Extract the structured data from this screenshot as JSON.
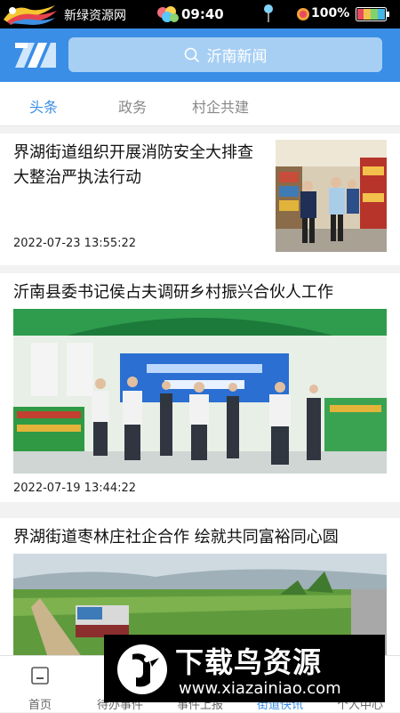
{
  "status_bar": {
    "app_name": "新绿资源网",
    "time": "09:40",
    "battery": "100%"
  },
  "header": {
    "search_placeholder": "沂南新闻"
  },
  "tabs": [
    {
      "label": "头条",
      "active": true
    },
    {
      "label": "政务",
      "active": false
    },
    {
      "label": "村企共建",
      "active": false
    }
  ],
  "articles": [
    {
      "title": "界湖街道组织开展消防安全大排查大整治严执法行动",
      "date": "2022-07-23 13:55:22"
    },
    {
      "title": "沂南县委书记侯占夫调研乡村振兴合伙人工作",
      "date": "2022-07-19 13:44:22"
    },
    {
      "title": "界湖街道枣林庄社企合作 绘就共同富裕同心圆",
      "date": ""
    }
  ],
  "bottom_nav": [
    {
      "label": "首页",
      "icon": "home-icon",
      "active": false
    },
    {
      "label": "待办事件",
      "icon": "todo-icon",
      "active": false
    },
    {
      "label": "事件上报",
      "icon": "report-icon",
      "active": false
    },
    {
      "label": "街道快讯",
      "icon": "news-icon",
      "active": true
    },
    {
      "label": "个人中心",
      "icon": "user-icon",
      "active": false
    }
  ],
  "watermark": {
    "title": "下载鸟资源",
    "url": "www.xiazainiao.com"
  },
  "colors": {
    "primary": "#3a8ee6",
    "search_bg": "#a7cff4",
    "tab_inactive": "#888888"
  }
}
